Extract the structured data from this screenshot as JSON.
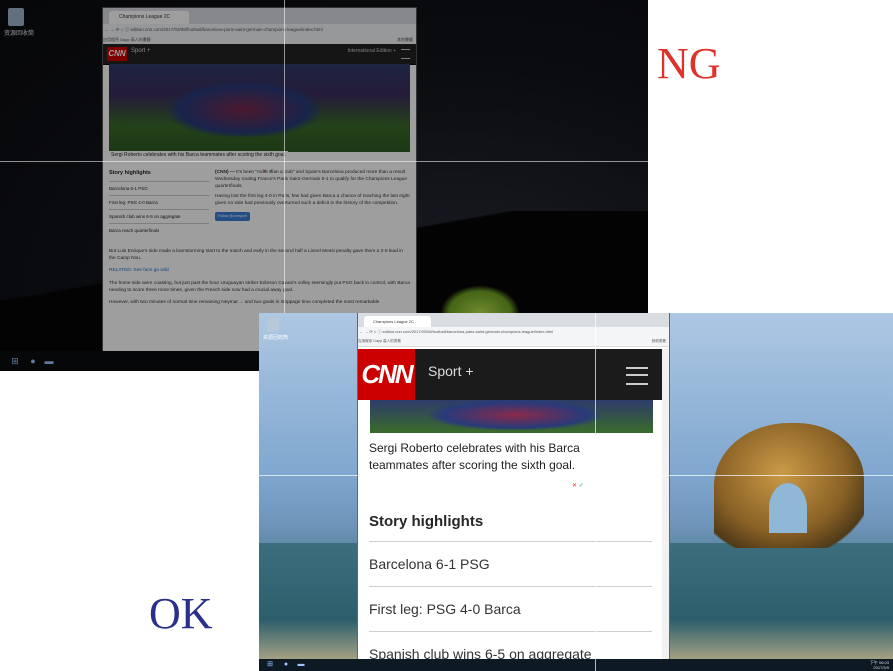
{
  "labels": {
    "ng": "NG",
    "ok": "OK"
  },
  "colors": {
    "ng_label": "#e0322d",
    "ok_label": "#2a2f8a",
    "cnn_red": "#cc0000",
    "link_blue": "#1a6fd1"
  },
  "ng": {
    "desktop_icon_label": "资源回收筒",
    "tab_title": "Champions League 2C",
    "address": "edition.cnn.com/2017/03/08/football/barcelona-paris-saint-germain-champions-league/index.html",
    "bookmarks": "应用程序   Dapp 高人的書籤",
    "bookmarks_right": "其他書籤",
    "cnn_logo": "CNN",
    "section": "Sport +",
    "edition": "International Edition +",
    "caption": "Sergi Roberto celebrates with his Barca teammates after scoring the sixth goal.",
    "reject_mark": "✕",
    "accept_mark": "✓",
    "highlights_title": "Story highlights",
    "highlights": [
      "Barcelona 6-1 PSG",
      "First leg: PSG 4-0 Barca",
      "Spanish club wins 6-5 on aggregate",
      "Barca reach quarterfinals"
    ],
    "body_1_lead": "(CNN) —",
    "body_1": "It's been \"more than a club\" and Spain's Barcelona produced more than a result Wednesday routing France's Paris Saint-Germain 6-1 to qualify for the Champions League quarterfinals.",
    "body_2": "Having lost the first leg 4-0 in Paris, few had given Barca a chance of reaching the last eight given no side had previously overturned such a deficit in the history of the competition.",
    "follow": "Follow @cnnsport",
    "para_1": "But Luis Enrique's side made a barnstorming start to the match and early in the second half a Lionel Messi penalty gave them a 3-0 lead in the Camp Nou.",
    "related": "RELATED: See fans go wild",
    "para_2": "The home side were coasting, but just past the hour Uruguayan striker Edinson Cavani's volley seemingly put PSG back in control, with Barca needing to score three more times, given the French side now had a crucial away goal.",
    "para_3": "However, with two minutes of normal time remaining Neymar ... and two goals in stoppage time completed the most remarkable"
  },
  "ok": {
    "desktop_icon_label": "资源回收筒",
    "tab_title": "Champions League 2C",
    "address": "edition.cnn.com/2017/03/08/football/barcelona-paris-saint-germain-champions-league/index.html",
    "bookmarks": "应用程序   Dapp 高人的書籤",
    "bookmarks_right": "其他書籤",
    "cnn_logo": "CNN",
    "section": "Sport +",
    "caption": "Sergi Roberto celebrates with his Barca teammates after scoring the sixth goal.",
    "reject_mark": "✕",
    "accept_mark": "✓",
    "highlights_title": "Story highlights",
    "highlights": [
      "Barcelona 6-1 PSG",
      "First leg: PSG 4-0 Barca",
      "Spanish club wins 6-5 on aggregate"
    ],
    "clock_time": "下午 06:03",
    "clock_date": "2017/3/9"
  }
}
